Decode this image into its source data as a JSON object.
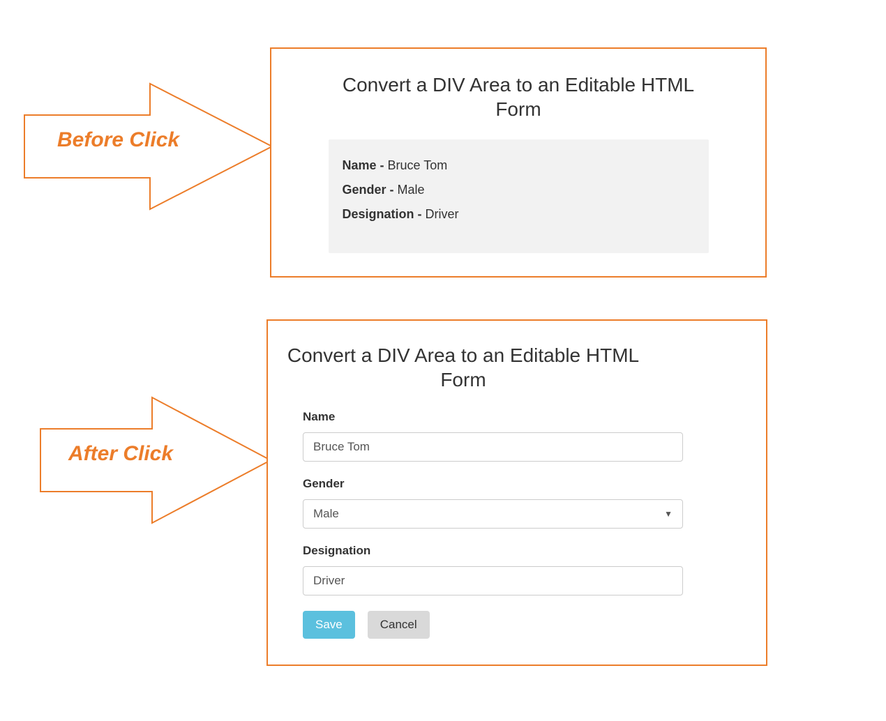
{
  "arrows": {
    "before_label": "Before Click",
    "after_label": "After Click"
  },
  "before_panel": {
    "title": "Convert a DIV Area to an Editable HTML Form",
    "fields": {
      "name_label": "Name - ",
      "name_value": "Bruce Tom",
      "gender_label": "Gender - ",
      "gender_value": "Male",
      "designation_label": "Designation - ",
      "designation_value": "Driver"
    }
  },
  "after_panel": {
    "title": "Convert a DIV Area to an Editable HTML Form",
    "form": {
      "name_label": "Name",
      "name_value": "Bruce Tom",
      "gender_label": "Gender",
      "gender_value": "Male",
      "designation_label": "Designation",
      "designation_value": "Driver",
      "save_label": "Save",
      "cancel_label": "Cancel"
    }
  },
  "colors": {
    "accent": "#EC7D2A",
    "save_btn": "#5bc0de",
    "cancel_btn": "#d9d9d9"
  }
}
